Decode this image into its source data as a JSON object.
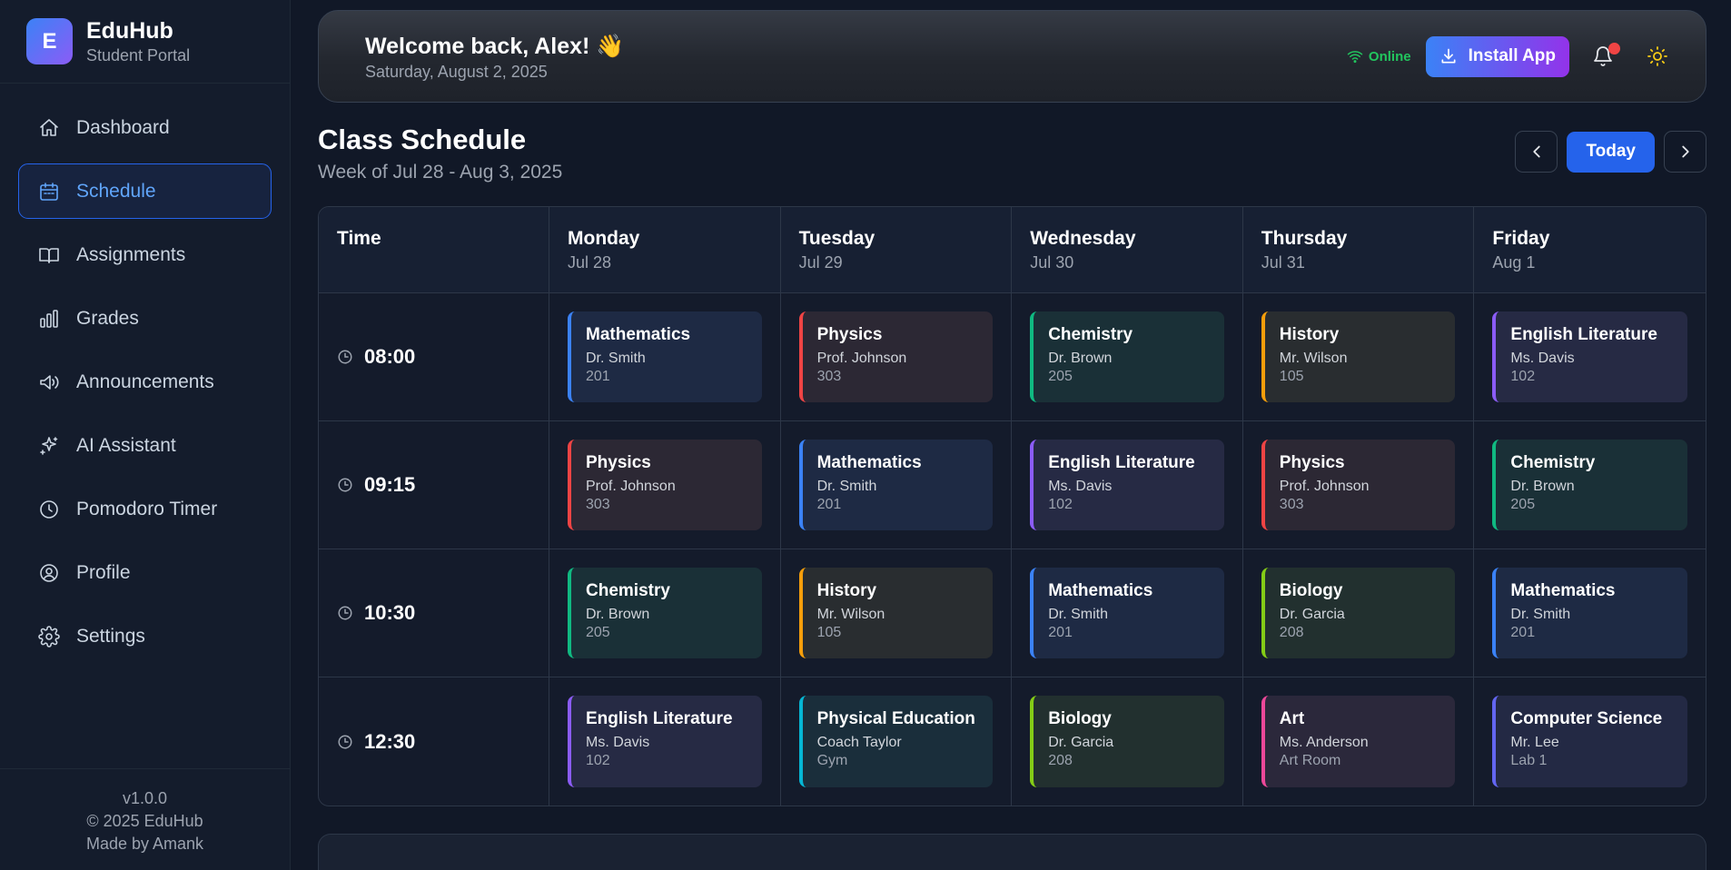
{
  "brand": {
    "logo_letter": "E",
    "name": "EduHub",
    "subtitle": "Student Portal"
  },
  "nav": [
    {
      "label": "Dashboard",
      "icon": "home-icon",
      "active": false
    },
    {
      "label": "Schedule",
      "icon": "calendar-icon",
      "active": true
    },
    {
      "label": "Assignments",
      "icon": "book-icon",
      "active": false
    },
    {
      "label": "Grades",
      "icon": "bar-chart-icon",
      "active": false
    },
    {
      "label": "Announcements",
      "icon": "megaphone-icon",
      "active": false
    },
    {
      "label": "AI Assistant",
      "icon": "sparkles-icon",
      "active": false
    },
    {
      "label": "Pomodoro Timer",
      "icon": "clock-icon",
      "active": false
    },
    {
      "label": "Profile",
      "icon": "user-circle-icon",
      "active": false
    },
    {
      "label": "Settings",
      "icon": "gear-icon",
      "active": false
    }
  ],
  "footer": {
    "version": "v1.0.0",
    "copyright": "© 2025 EduHub",
    "credit": "Made by Amank"
  },
  "header": {
    "welcome": "Welcome back, Alex! 👋",
    "date": "Saturday, August 2, 2025",
    "status": "Online",
    "install_label": "Install App",
    "has_notification": true
  },
  "schedule": {
    "title": "Class Schedule",
    "week": "Week of Jul 28 - Aug 3, 2025",
    "today_label": "Today",
    "time_header": "Time",
    "days": [
      {
        "day": "Monday",
        "date": "Jul 28"
      },
      {
        "day": "Tuesday",
        "date": "Jul 29"
      },
      {
        "day": "Wednesday",
        "date": "Jul 30"
      },
      {
        "day": "Thursday",
        "date": "Jul 31"
      },
      {
        "day": "Friday",
        "date": "Aug 1"
      }
    ],
    "rows": [
      {
        "time": "08:00",
        "classes": [
          {
            "subject": "Mathematics",
            "teacher": "Dr. Smith",
            "room": "201"
          },
          {
            "subject": "Physics",
            "teacher": "Prof. Johnson",
            "room": "303"
          },
          {
            "subject": "Chemistry",
            "teacher": "Dr. Brown",
            "room": "205"
          },
          {
            "subject": "History",
            "teacher": "Mr. Wilson",
            "room": "105"
          },
          {
            "subject": "English Literature",
            "teacher": "Ms. Davis",
            "room": "102"
          }
        ]
      },
      {
        "time": "09:15",
        "classes": [
          {
            "subject": "Physics",
            "teacher": "Prof. Johnson",
            "room": "303"
          },
          {
            "subject": "Mathematics",
            "teacher": "Dr. Smith",
            "room": "201"
          },
          {
            "subject": "English Literature",
            "teacher": "Ms. Davis",
            "room": "102"
          },
          {
            "subject": "Physics",
            "teacher": "Prof. Johnson",
            "room": "303"
          },
          {
            "subject": "Chemistry",
            "teacher": "Dr. Brown",
            "room": "205"
          }
        ]
      },
      {
        "time": "10:30",
        "classes": [
          {
            "subject": "Chemistry",
            "teacher": "Dr. Brown",
            "room": "205"
          },
          {
            "subject": "History",
            "teacher": "Mr. Wilson",
            "room": "105"
          },
          {
            "subject": "Mathematics",
            "teacher": "Dr. Smith",
            "room": "201"
          },
          {
            "subject": "Biology",
            "teacher": "Dr. Garcia",
            "room": "208"
          },
          {
            "subject": "Mathematics",
            "teacher": "Dr. Smith",
            "room": "201"
          }
        ]
      },
      {
        "time": "12:30",
        "classes": [
          {
            "subject": "English Literature",
            "teacher": "Ms. Davis",
            "room": "102"
          },
          {
            "subject": "Physical Education",
            "teacher": "Coach Taylor",
            "room": "Gym"
          },
          {
            "subject": "Biology",
            "teacher": "Dr. Garcia",
            "room": "208"
          },
          {
            "subject": "Art",
            "teacher": "Ms. Anderson",
            "room": "Art Room"
          },
          {
            "subject": "Computer Science",
            "teacher": "Mr. Lee",
            "room": "Lab 1"
          }
        ]
      }
    ]
  },
  "subject_colors": {
    "Mathematics": {
      "accent": "#3b82f6",
      "bg": "#1e2a44"
    },
    "Physics": {
      "accent": "#ef4444",
      "bg": "#2c2834"
    },
    "Chemistry": {
      "accent": "#10b981",
      "bg": "#1a3037"
    },
    "History": {
      "accent": "#f59e0b",
      "bg": "#292d30"
    },
    "English Literature": {
      "accent": "#8b5cf6",
      "bg": "#262a44"
    },
    "Biology": {
      "accent": "#84cc16",
      "bg": "#22302f"
    },
    "Physical Education": {
      "accent": "#06b6d4",
      "bg": "#1a2e3b"
    },
    "Art": {
      "accent": "#ec4899",
      "bg": "#2b283b"
    },
    "Computer Science": {
      "accent": "#6366f1",
      "bg": "#232944"
    }
  }
}
